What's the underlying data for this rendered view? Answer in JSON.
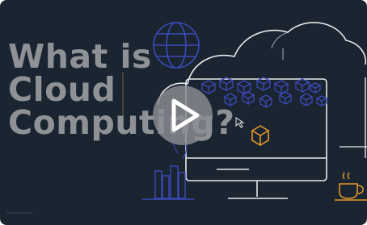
{
  "video": {
    "title_lines": [
      "What is",
      "Cloud",
      "Computing?"
    ]
  },
  "icons": {
    "play": "play-icon",
    "globe": "globe-icon",
    "cube": "cube-icon",
    "cursor": "cursor-arrow-icon",
    "cloud": "cloud-outline-icon",
    "monitor": "monitor-icon",
    "books": "books-icon",
    "coffee": "coffee-cup-icon",
    "plant": "plant-icon"
  },
  "colors": {
    "background": "#1b2431",
    "line_art": "#e8eaed",
    "accent_blue": "#3b4bb8",
    "accent_orange": "#e39a2b",
    "title_text": "#8e9296"
  }
}
